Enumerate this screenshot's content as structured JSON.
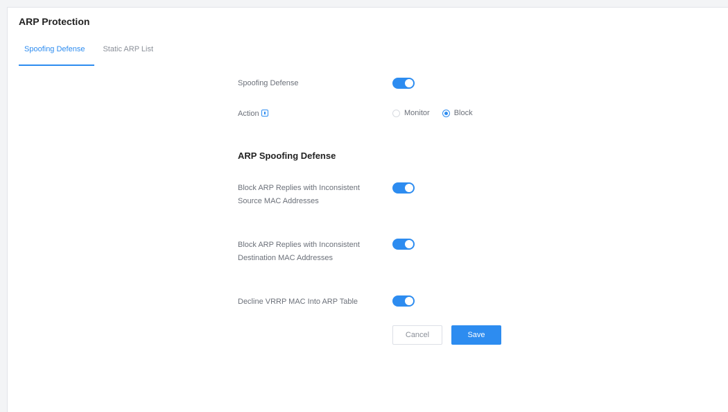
{
  "page": {
    "title": "ARP Protection"
  },
  "tabs": [
    {
      "label": "Spoofing Defense",
      "active": true
    },
    {
      "label": "Static ARP List",
      "active": false
    }
  ],
  "form": {
    "spoofing_defense": {
      "label": "Spoofing Defense",
      "enabled": true
    },
    "action": {
      "label": "Action",
      "options": [
        "Monitor",
        "Block"
      ],
      "selected": "Block"
    },
    "section_title": "ARP Spoofing Defense",
    "block_src_mac": {
      "label": "Block ARP Replies with Inconsistent Source MAC Addresses",
      "enabled": true
    },
    "block_dst_mac": {
      "label": "Block ARP Replies with Inconsistent Destination MAC Addresses",
      "enabled": true
    },
    "decline_vrrp": {
      "label": "Decline VRRP MAC Into ARP Table",
      "enabled": true
    }
  },
  "buttons": {
    "cancel_label": "Cancel",
    "save_label": "Save"
  },
  "colors": {
    "accent": "#2d8cf0"
  }
}
